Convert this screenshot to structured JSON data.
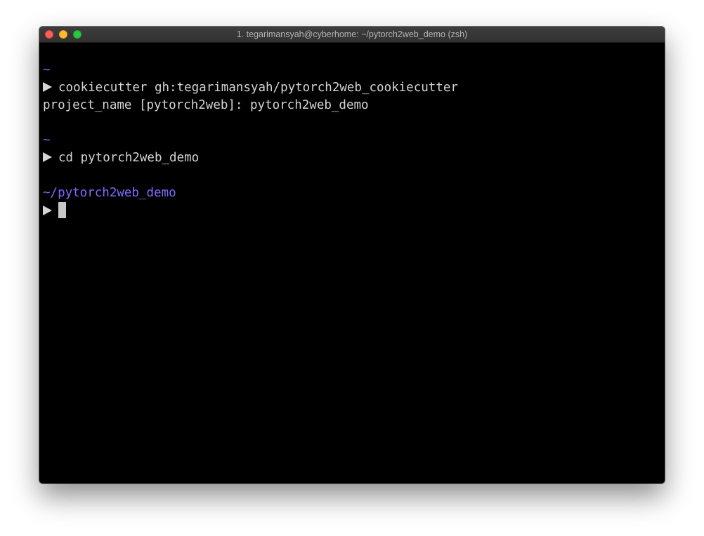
{
  "window": {
    "title": "1. tegarimansyah@cyberhome: ~/pytorch2web_demo (zsh)"
  },
  "colors": {
    "path": "#7b6cff",
    "text": "#d4d4d4",
    "background": "#000000"
  },
  "terminal": {
    "block1": {
      "cwd": "~",
      "command": "cookiecutter gh:tegarimansyah/pytorch2web_cookiecutter",
      "output": "project_name [pytorch2web]: pytorch2web_demo"
    },
    "block2": {
      "cwd": "~",
      "command": "cd pytorch2web_demo"
    },
    "block3": {
      "cwd": "~/pytorch2web_demo",
      "command": ""
    }
  }
}
